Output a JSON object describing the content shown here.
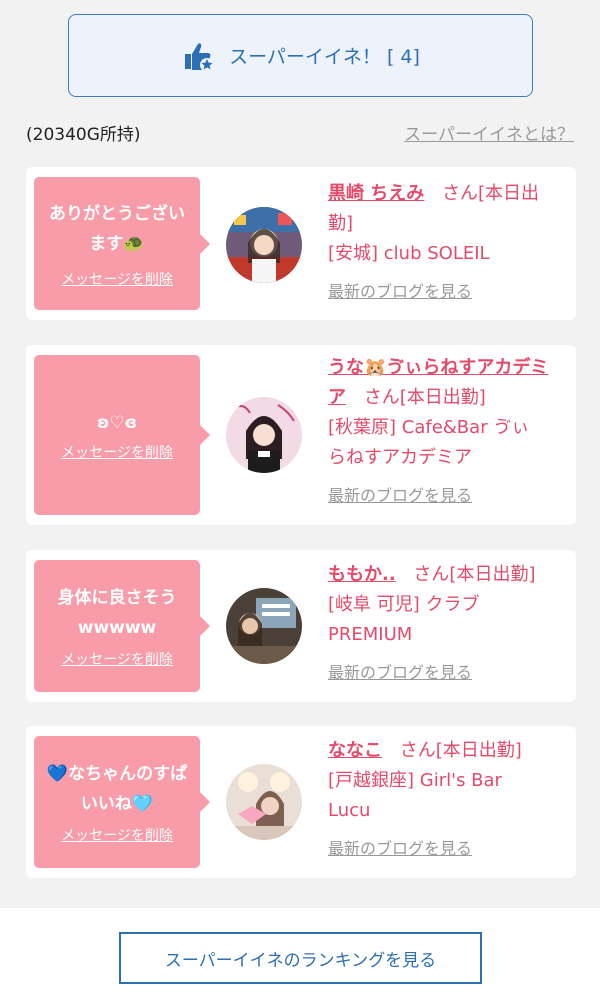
{
  "super_iine": {
    "label": "スーパーイイネ！ [ 4]",
    "icon": "thumbs-up-star-icon"
  },
  "points_text": "(20340G所持)",
  "about_link": "スーパーイイネとは？",
  "delete_label": "メッセージを削除",
  "blog_label": "最新のブログを見る",
  "cards": [
    {
      "message_line1": "ありがとうござい",
      "message_line2": "ます🐢",
      "name": "黒崎 ちえみ",
      "san": "さん[本日出勤]",
      "shop_line1": "[安城] club SOLEIL",
      "shop_line2": ""
    },
    {
      "message_line1": "ʚ♡ɞ",
      "message_line2": "",
      "name": "うな🐹ゔぃらねすアカデミア",
      "san": "さん[本日出勤]",
      "shop_line1": "[秋葉原] Cafe&Bar ゔぃ",
      "shop_line2": "らねすアカデミア"
    },
    {
      "message_line1": "身体に良さそう",
      "message_line2": "wwwww",
      "name": "ももか..",
      "san": "さん[本日出勤]",
      "shop_line1": "[岐阜 可児] クラブ",
      "shop_line2": "PREMIUM"
    },
    {
      "message_line1": "💙なちゃんのすぱ",
      "message_line2": "いいね🩵",
      "name": "ななこ",
      "san": "さん[本日出勤]",
      "shop_line1": "[戸越銀座] Girl's Bar",
      "shop_line2": "Lucu"
    }
  ],
  "ranking_button": "スーパーイイネのランキングを見る"
}
